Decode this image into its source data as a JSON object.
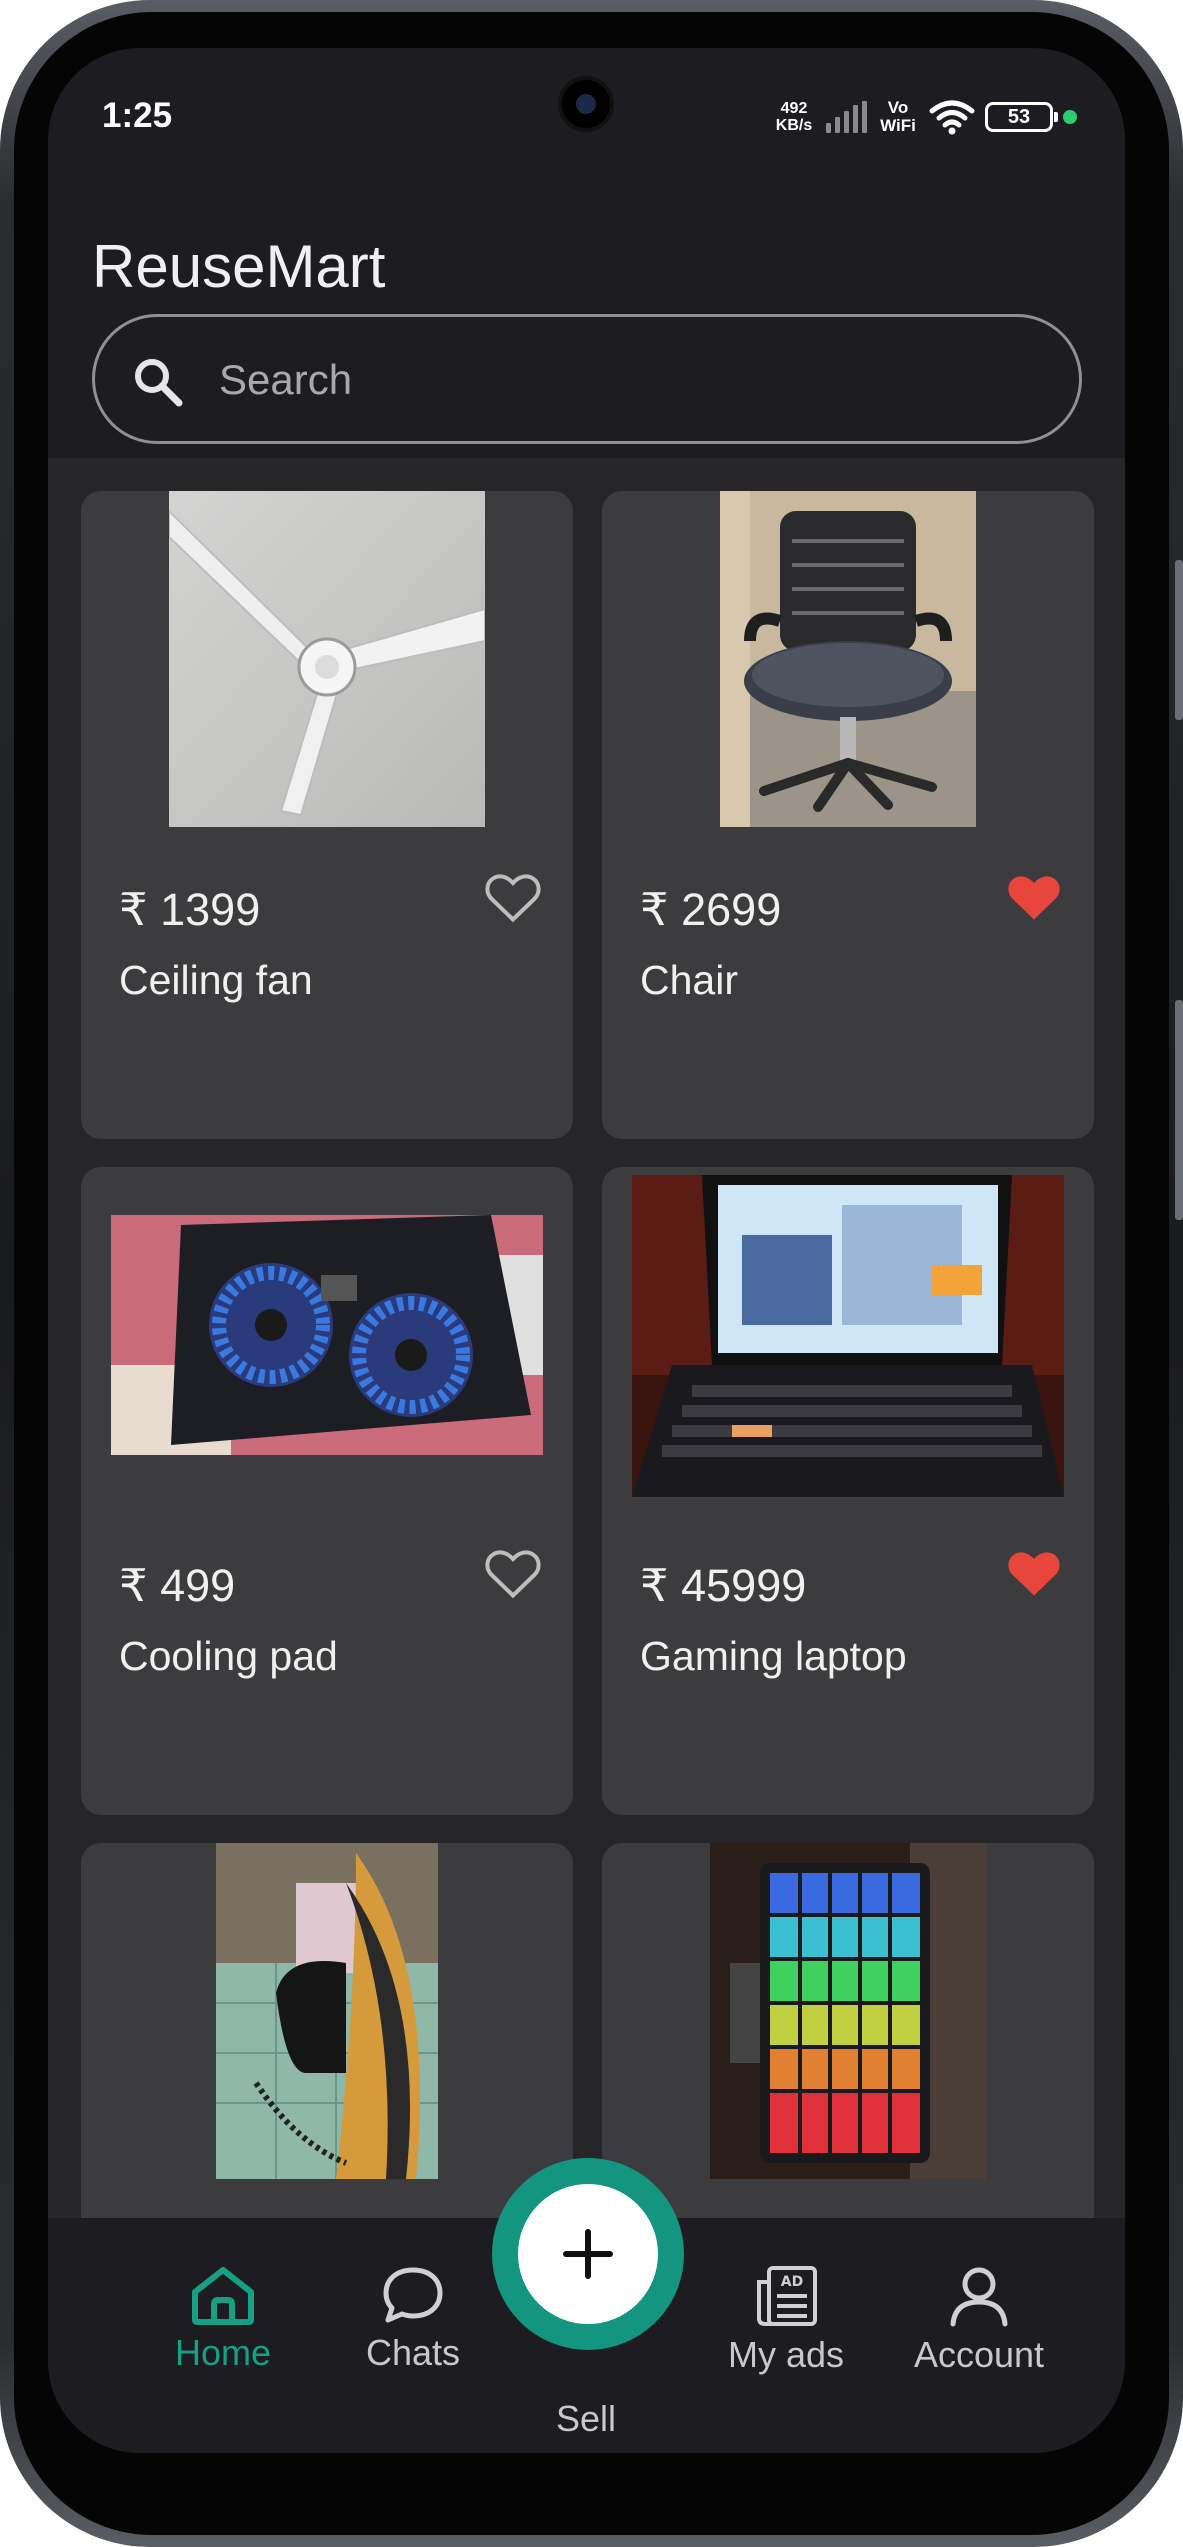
{
  "status_bar": {
    "time": "1:25",
    "net_speed_value": "492",
    "net_speed_unit": "KB/s",
    "vowifi_top": "Vo",
    "vowifi_bottom": "WiFi",
    "battery_level": "53"
  },
  "header": {
    "title": "ReuseMart",
    "search_placeholder": "Search"
  },
  "products": [
    {
      "price": "₹ 1399",
      "title": "Ceiling fan",
      "favorite": false
    },
    {
      "price": "₹ 2699",
      "title": "Chair",
      "favorite": true
    },
    {
      "price": "₹ 499",
      "title": "Cooling pad",
      "favorite": false
    },
    {
      "price": "₹ 45999",
      "title": "Gaming laptop",
      "favorite": true
    },
    {
      "price": "",
      "title": "",
      "favorite": false
    },
    {
      "price": "",
      "title": "",
      "favorite": false
    }
  ],
  "bottom_nav": {
    "home": "Home",
    "chats": "Chats",
    "sell": "Sell",
    "my_ads": "My ads",
    "account": "Account"
  },
  "colors": {
    "accent": "#16a086",
    "favorite": "#e8453c",
    "background": "#1d1c20",
    "card": "#3c3c3e"
  }
}
